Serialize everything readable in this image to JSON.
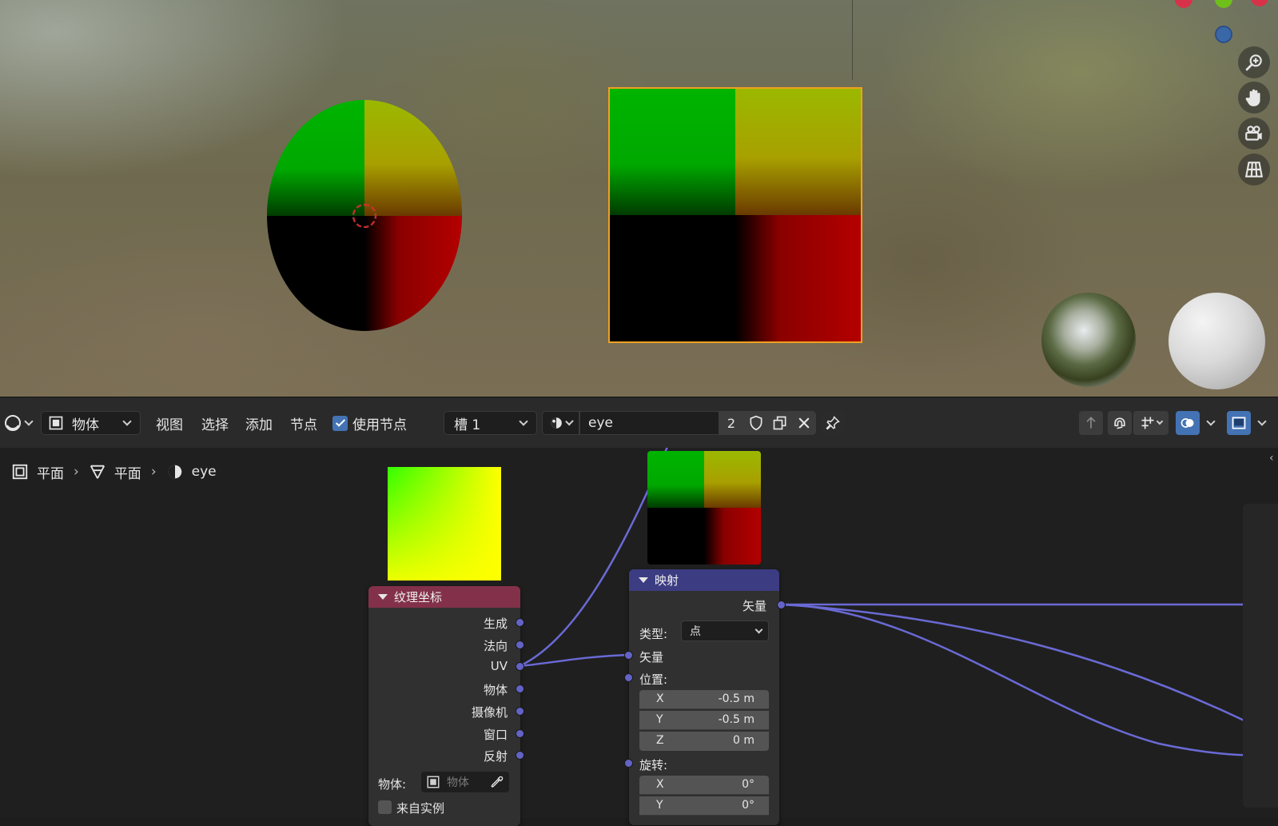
{
  "header": {
    "editor_type_icon": "shader-editor-icon",
    "object_mode": "物体",
    "menus": [
      "视图",
      "选择",
      "添加",
      "节点"
    ],
    "use_nodes_label": "使用节点",
    "use_nodes_checked": true,
    "slot": "槽 1",
    "material_name": "eye",
    "user_count": "2",
    "icons": [
      "fake-user-shield-icon",
      "duplicate-icon",
      "unlink-x-icon",
      "pin-icon",
      "parent-node-icon",
      "snap-magnet-icon",
      "snap-grid-icon",
      "overlay-icon",
      "sidebar-toggle-icon"
    ]
  },
  "breadcrumb": {
    "items": [
      "平面",
      "平面",
      "eye"
    ],
    "icons": [
      "object-icon",
      "mesh-icon",
      "material-icon"
    ]
  },
  "viewport": {
    "nav_icons": [
      "zoom-icon",
      "hand-pan-icon",
      "camera-icon",
      "grid-ortho-icon"
    ],
    "gizmo_colors": [
      "#d8324a",
      "#6fbf1a",
      "#3a67a8"
    ]
  },
  "nodes": {
    "texcoord": {
      "title": "纹理坐标",
      "header_color": "#83314a",
      "outputs": [
        "生成",
        "法向",
        "UV",
        "物体",
        "摄像机",
        "窗口",
        "反射"
      ],
      "object_label": "物体:",
      "object_placeholder": "物体",
      "from_instancer_label": "来自实例",
      "from_instancer_checked": false
    },
    "mapping": {
      "title": "映射",
      "header_color": "#3c3c83",
      "output": "矢量",
      "type_label": "类型:",
      "type_value": "点",
      "vector_input": "矢量",
      "location_label": "位置:",
      "location": [
        {
          "axis": "X",
          "value": "-0.5 m"
        },
        {
          "axis": "Y",
          "value": "-0.5 m"
        },
        {
          "axis": "Z",
          "value": "0 m"
        }
      ],
      "rotation_label": "旋转:",
      "rotation": [
        {
          "axis": "X",
          "value": "0°"
        },
        {
          "axis": "Y",
          "value": "0°"
        }
      ]
    }
  }
}
